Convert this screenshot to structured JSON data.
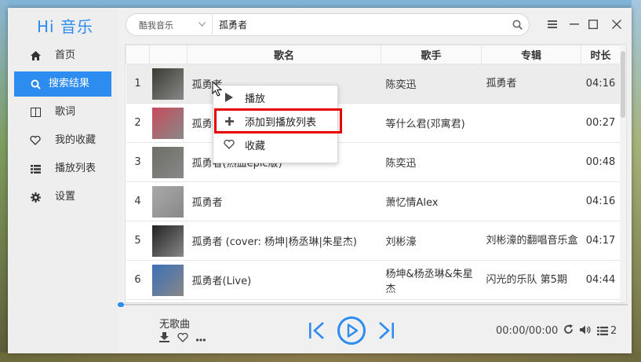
{
  "app": {
    "logo": "Hi 音乐"
  },
  "sidebar": {
    "items": [
      {
        "label": "首页",
        "icon": "home-icon"
      },
      {
        "label": "搜索结果",
        "icon": "search-icon"
      },
      {
        "label": "歌词",
        "icon": "lyrics-icon"
      },
      {
        "label": "我的收藏",
        "icon": "heart-icon"
      },
      {
        "label": "播放列表",
        "icon": "list-icon"
      },
      {
        "label": "设置",
        "icon": "gear-icon"
      }
    ],
    "active_index": 1
  },
  "search": {
    "source": "酷我音乐",
    "query": "孤勇者"
  },
  "table": {
    "headers": {
      "title": "歌名",
      "artist": "歌手",
      "album": "专辑",
      "duration": "时长"
    },
    "rows": [
      {
        "index": "1",
        "title": "孤勇者",
        "artist": "陈奕迅",
        "album": "孤勇者",
        "duration": "04:16",
        "cover": "#3b3b33"
      },
      {
        "index": "2",
        "title": "孤勇",
        "artist": "等什么君(邓寓君)",
        "album": "",
        "duration": "00:27",
        "cover": "#c74c5a"
      },
      {
        "index": "3",
        "title": "孤勇者(热血epic版)",
        "artist": "陈奕迅",
        "album": "",
        "duration": "00:48",
        "cover": "#6e6e66"
      },
      {
        "index": "4",
        "title": "孤勇者",
        "artist": "萧忆情Alex",
        "album": "",
        "duration": "04:16",
        "cover": "#a8aaa8"
      },
      {
        "index": "5",
        "title": "孤勇者 (cover: 杨坤|杨丞琳|朱星杰)",
        "artist": "刘彬濠",
        "album": "刘彬濠的翻唱音乐盒",
        "duration": "04:17",
        "cover": "#222222"
      },
      {
        "index": "6",
        "title": "孤勇者(Live)",
        "artist": "杨坤&杨丞琳&朱星杰",
        "album": "闪光的乐队 第5期",
        "duration": "04:44",
        "cover": "#3a6fb8"
      }
    ]
  },
  "context_menu": {
    "items": [
      {
        "label": "播放",
        "icon": "play-icon"
      },
      {
        "label": "添加到播放列表",
        "icon": "plus-icon"
      },
      {
        "label": "收藏",
        "icon": "heart-icon"
      }
    ],
    "highlighted_index": 1
  },
  "player": {
    "now_playing": "无歌曲",
    "time": "00:00/00:00",
    "playlist_count": "2",
    "progress": 0
  },
  "colors": {
    "accent": "#2d8cf0",
    "highlight_border": "#e60000"
  }
}
